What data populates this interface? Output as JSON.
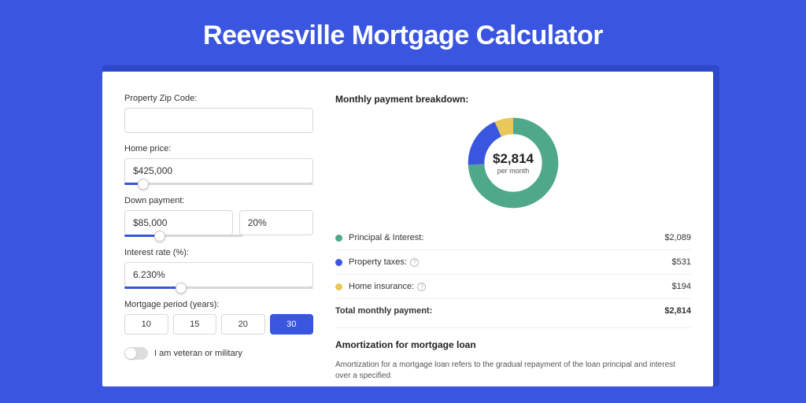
{
  "title": "Reevesville Mortgage Calculator",
  "form": {
    "zip_label": "Property Zip Code:",
    "zip_value": "",
    "home_price_label": "Home price:",
    "home_price_value": "$425,000",
    "home_price_slider_pct": 10,
    "down_payment_label": "Down payment:",
    "down_payment_value": "$85,000",
    "down_payment_pct_value": "20%",
    "down_payment_slider_pct": 20,
    "interest_label": "Interest rate (%):",
    "interest_value": "6.230%",
    "interest_slider_pct": 30,
    "period_label": "Mortgage period (years):",
    "period_options": [
      "10",
      "15",
      "20",
      "30"
    ],
    "period_selected": "30",
    "veteran_label": "I am veteran or military"
  },
  "breakdown": {
    "title": "Monthly payment breakdown:",
    "donut_amount": "$2,814",
    "donut_sub": "per month",
    "rows": [
      {
        "label": "Principal & Interest:",
        "value": "$2,089",
        "color": "green",
        "info": false
      },
      {
        "label": "Property taxes:",
        "value": "$531",
        "color": "blue",
        "info": true
      },
      {
        "label": "Home insurance:",
        "value": "$194",
        "color": "yellow",
        "info": true
      }
    ],
    "total_label": "Total monthly payment:",
    "total_value": "$2,814"
  },
  "amortization": {
    "title": "Amortization for mortgage loan",
    "text": "Amortization for a mortgage loan refers to the gradual repayment of the loan principal and interest over a specified"
  },
  "chart_data": {
    "type": "pie",
    "title": "Monthly payment breakdown",
    "series": [
      {
        "name": "Principal & Interest",
        "value": 2089,
        "color": "#4fa88a"
      },
      {
        "name": "Property taxes",
        "value": 531,
        "color": "#3a55e0"
      },
      {
        "name": "Home insurance",
        "value": 194,
        "color": "#e8c85a"
      }
    ],
    "total": 2814
  }
}
